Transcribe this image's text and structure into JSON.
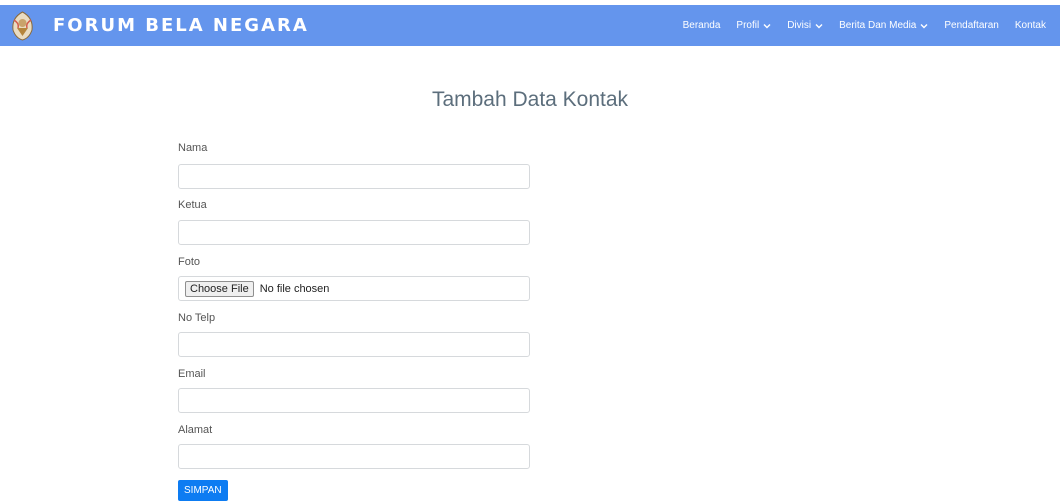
{
  "brand": {
    "name": "FORUM BELA NEGARA"
  },
  "nav": {
    "items": [
      {
        "label": "Beranda"
      },
      {
        "label": "Profil"
      },
      {
        "label": "Divisi"
      },
      {
        "label": "Berita Dan Media"
      },
      {
        "label": "Pendaftaran"
      },
      {
        "label": "Kontak"
      }
    ]
  },
  "form": {
    "title": "Tambah Data Kontak",
    "fields": [
      {
        "label": "Nama",
        "value": ""
      },
      {
        "label": "Ketua",
        "value": ""
      },
      {
        "label": "Foto",
        "button": "Choose File",
        "status": "No file chosen"
      },
      {
        "label": "No Telp",
        "value": ""
      },
      {
        "label": "Email",
        "value": ""
      },
      {
        "label": "Alamat",
        "value": ""
      }
    ],
    "submit_label": "SIMPAN"
  },
  "colors": {
    "navbar": "#6495ed",
    "submit": "#0d7cf2",
    "title": "#5c6e7c"
  }
}
